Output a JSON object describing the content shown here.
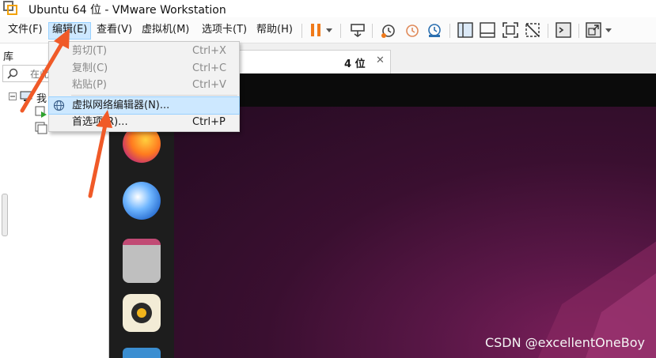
{
  "window": {
    "title": "Ubuntu 64 位 - VMware Workstation"
  },
  "menubar": {
    "items": [
      {
        "label": "文件(F)"
      },
      {
        "label": "编辑(E)"
      },
      {
        "label": "查看(V)"
      },
      {
        "label": "虚拟机(M)"
      },
      {
        "label": "选项卡(T)"
      },
      {
        "label": "帮助(H)"
      }
    ]
  },
  "toolbar": {
    "icons": [
      "pause-icon",
      "dropdown-arrow-icon",
      "send-keys-icon",
      "snapshot-icon",
      "revert-snapshot-icon",
      "snapshot-manager-icon",
      "show-library-icon",
      "thumbnail-bar-icon",
      "fullscreen-icon",
      "unity-icon",
      "console-icon",
      "stretch-icon"
    ]
  },
  "library": {
    "title": "库",
    "search_placeholder": "在此",
    "tree_root_label": "我"
  },
  "tab": {
    "label": "4 位"
  },
  "edit_menu": {
    "items": [
      {
        "label": "剪切(T)",
        "shortcut": "Ctrl+X",
        "enabled": false
      },
      {
        "label": "复制(C)",
        "shortcut": "Ctrl+C",
        "enabled": false
      },
      {
        "label": "粘贴(P)",
        "shortcut": "Ctrl+V",
        "enabled": false
      },
      {
        "label": "虚拟网络编辑器(N)...",
        "shortcut": "",
        "enabled": true,
        "highlighted": true
      },
      {
        "label": "首选项(R)...",
        "shortcut": "Ctrl+P",
        "enabled": true
      }
    ]
  },
  "dock": {
    "apps": [
      "firefox-icon",
      "thunderbird-icon",
      "files-icon",
      "rhythmbox-icon"
    ]
  },
  "watermark": "CSDN @excellentOneBoy",
  "colors": {
    "highlight": "#cde8ff",
    "ubuntu_bg": "#3a0f30",
    "pause": "#f07a1a",
    "arrow": "#f05a28"
  }
}
